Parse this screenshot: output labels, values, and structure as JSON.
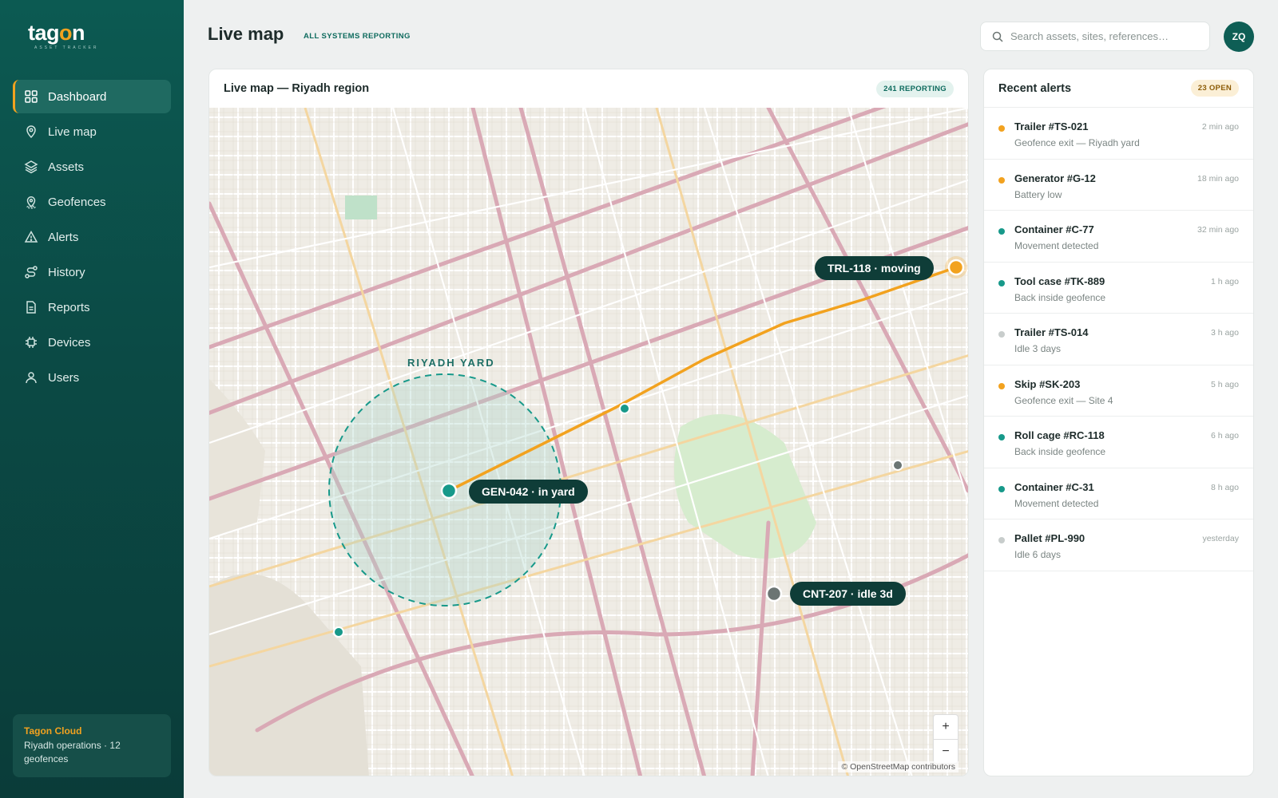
{
  "brand": {
    "name": "tagon",
    "tagline": "ASSET TRACKER"
  },
  "nav": [
    {
      "label": "Dashboard",
      "icon": "grid-icon",
      "active": true
    },
    {
      "label": "Live map",
      "icon": "map-pin-icon"
    },
    {
      "label": "Assets",
      "icon": "layers-icon"
    },
    {
      "label": "Geofences",
      "icon": "geofence-icon"
    },
    {
      "label": "Alerts",
      "icon": "warning-icon"
    },
    {
      "label": "History",
      "icon": "route-icon"
    },
    {
      "label": "Reports",
      "icon": "document-icon"
    },
    {
      "label": "Devices",
      "icon": "chip-icon"
    },
    {
      "label": "Users",
      "icon": "user-icon"
    }
  ],
  "cloud": {
    "title": "Tagon Cloud",
    "desc": "Riyadh operations · 12 geofences"
  },
  "header": {
    "title": "Live map",
    "status": "ALL SYSTEMS REPORTING",
    "search_placeholder": "Search assets, sites, references…",
    "avatar": "ZQ"
  },
  "map": {
    "title": "Live map — Riyadh region",
    "badge": "241 REPORTING",
    "yard_label": "RIYADH YARD",
    "markers": [
      {
        "label": "TRL-118 · moving",
        "color": "#f2a21f"
      },
      {
        "label": "GEN-042 · in yard",
        "color": "#17998a"
      },
      {
        "label": "CNT-207 · idle 3d",
        "color": "#6b7573"
      }
    ],
    "zoom_in": "+",
    "zoom_out": "−",
    "attribution": "© OpenStreetMap contributors"
  },
  "alerts": {
    "title": "Recent alerts",
    "badge": "23 OPEN",
    "items": [
      {
        "name": "Trailer #TS-021",
        "desc": "Geofence exit — Riyadh yard",
        "time": "2 min ago",
        "color": "#f2a21f"
      },
      {
        "name": "Generator #G-12",
        "desc": "Battery low",
        "time": "18 min ago",
        "color": "#f2a21f"
      },
      {
        "name": "Container #C-77",
        "desc": "Movement detected",
        "time": "32 min ago",
        "color": "#17998a"
      },
      {
        "name": "Tool case #TK-889",
        "desc": "Back inside geofence",
        "time": "1 h ago",
        "color": "#17998a"
      },
      {
        "name": "Trailer #TS-014",
        "desc": "Idle 3 days",
        "time": "3 h ago",
        "color": "#c8cdcc"
      },
      {
        "name": "Skip #SK-203",
        "desc": "Geofence exit — Site 4",
        "time": "5 h ago",
        "color": "#f2a21f"
      },
      {
        "name": "Roll cage #RC-118",
        "desc": "Back inside geofence",
        "time": "6 h ago",
        "color": "#17998a"
      },
      {
        "name": "Container #C-31",
        "desc": "Movement detected",
        "time": "8 h ago",
        "color": "#17998a"
      },
      {
        "name": "Pallet #PL-990",
        "desc": "Idle 6 days",
        "time": "yesterday",
        "color": "#c8cdcc"
      }
    ]
  }
}
